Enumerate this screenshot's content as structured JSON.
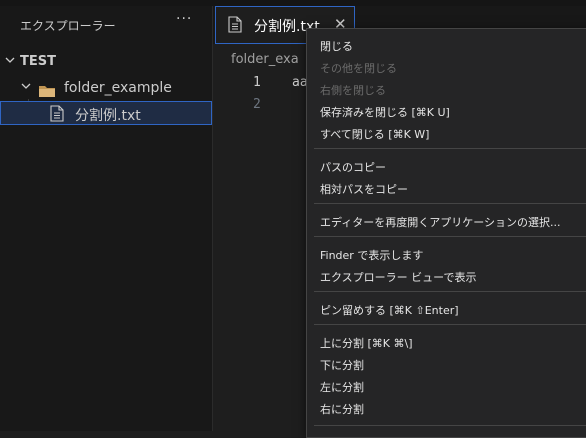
{
  "sidebar": {
    "title": "エクスプローラー",
    "more": "···",
    "workspace": "TEST",
    "folder": "folder_example",
    "file": "分割例.txt"
  },
  "editor": {
    "tab": {
      "label": "分割例.txt",
      "close": "✕"
    },
    "breadcrumb": "folder_exa",
    "lines": [
      {
        "number": "1",
        "text": "aa"
      },
      {
        "number": "2",
        "text": ""
      }
    ]
  },
  "context_menu": {
    "items": [
      {
        "label": "閉じる",
        "enabled": true
      },
      {
        "label": "その他を閉じる",
        "enabled": false
      },
      {
        "label": "右側を閉じる",
        "enabled": false
      },
      {
        "label": "保存済みを閉じる [⌘K U]",
        "enabled": true
      },
      {
        "label": "すべて閉じる [⌘K W]",
        "enabled": true
      },
      {
        "label": "パスのコピー",
        "enabled": true
      },
      {
        "label": "相対パスをコピー",
        "enabled": true
      },
      {
        "label": "エディターを再度開くアプリケーションの選択...",
        "enabled": true
      },
      {
        "label": "Finder で表示します",
        "enabled": true
      },
      {
        "label": "エクスプローラー ビューで表示",
        "enabled": true
      },
      {
        "label": "ピン留めする [⌘K ⇧Enter]",
        "enabled": true
      },
      {
        "label": "上に分割 [⌘K ⌘\\]",
        "enabled": true
      },
      {
        "label": "下に分割",
        "enabled": true
      },
      {
        "label": "左に分割",
        "enabled": true
      },
      {
        "label": "右に分割",
        "enabled": true
      }
    ]
  }
}
